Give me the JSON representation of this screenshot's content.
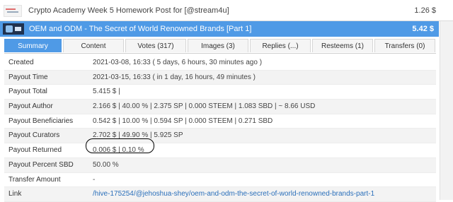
{
  "top_post": {
    "title": "Crypto Academy Week 5 Homework Post for [@stream4u]",
    "amount": "1.26 $"
  },
  "selected_post": {
    "title": "OEM and ODM - The Secret of World Renowned Brands [Part 1]",
    "amount": "5.42 $"
  },
  "tabs": [
    {
      "label": "Summary",
      "active": true
    },
    {
      "label": "Content"
    },
    {
      "label": "Votes (317)"
    },
    {
      "label": "Images (3)"
    },
    {
      "label": "Replies (...)"
    },
    {
      "label": "Resteems (1)"
    },
    {
      "label": "Transfers (0)"
    }
  ],
  "rows": [
    {
      "label": "Created",
      "value": "2021-03-08, 16:33   ( 5 days, 6 hours, 30 minutes ago )"
    },
    {
      "label": "Payout Time",
      "value": "2021-03-15, 16:33   ( in 1 day, 16 hours, 49 minutes )"
    },
    {
      "label": "Payout Total",
      "value": "5.415  $   |"
    },
    {
      "label": "Payout Author",
      "value": "2.166  $   |   40.00  %   |   2.375  SP   |   0.000  STEEM   |   1.083  SBD   |   ~ 8.66  USD"
    },
    {
      "label": "Payout Beneficiaries",
      "value": "0.542  $   |   10.00  %   |   0.594  SP   |   0.000  STEEM   |   0.271  SBD"
    },
    {
      "label": "Payout Curators",
      "value": "2.702  $   |   49.90  %   |   5.925  SP"
    },
    {
      "label": "Payout Returned",
      "value": "0.006  $   |     0.10  %"
    },
    {
      "label": "Payout Percent SBD",
      "value": "50.00  %"
    },
    {
      "label": "Transfer Amount",
      "value": "-"
    },
    {
      "label": "Link",
      "value": "/hive-175254/@jehoshua-shey/oem-and-odm-the-secret-of-world-renowned-brands-part-1"
    }
  ]
}
